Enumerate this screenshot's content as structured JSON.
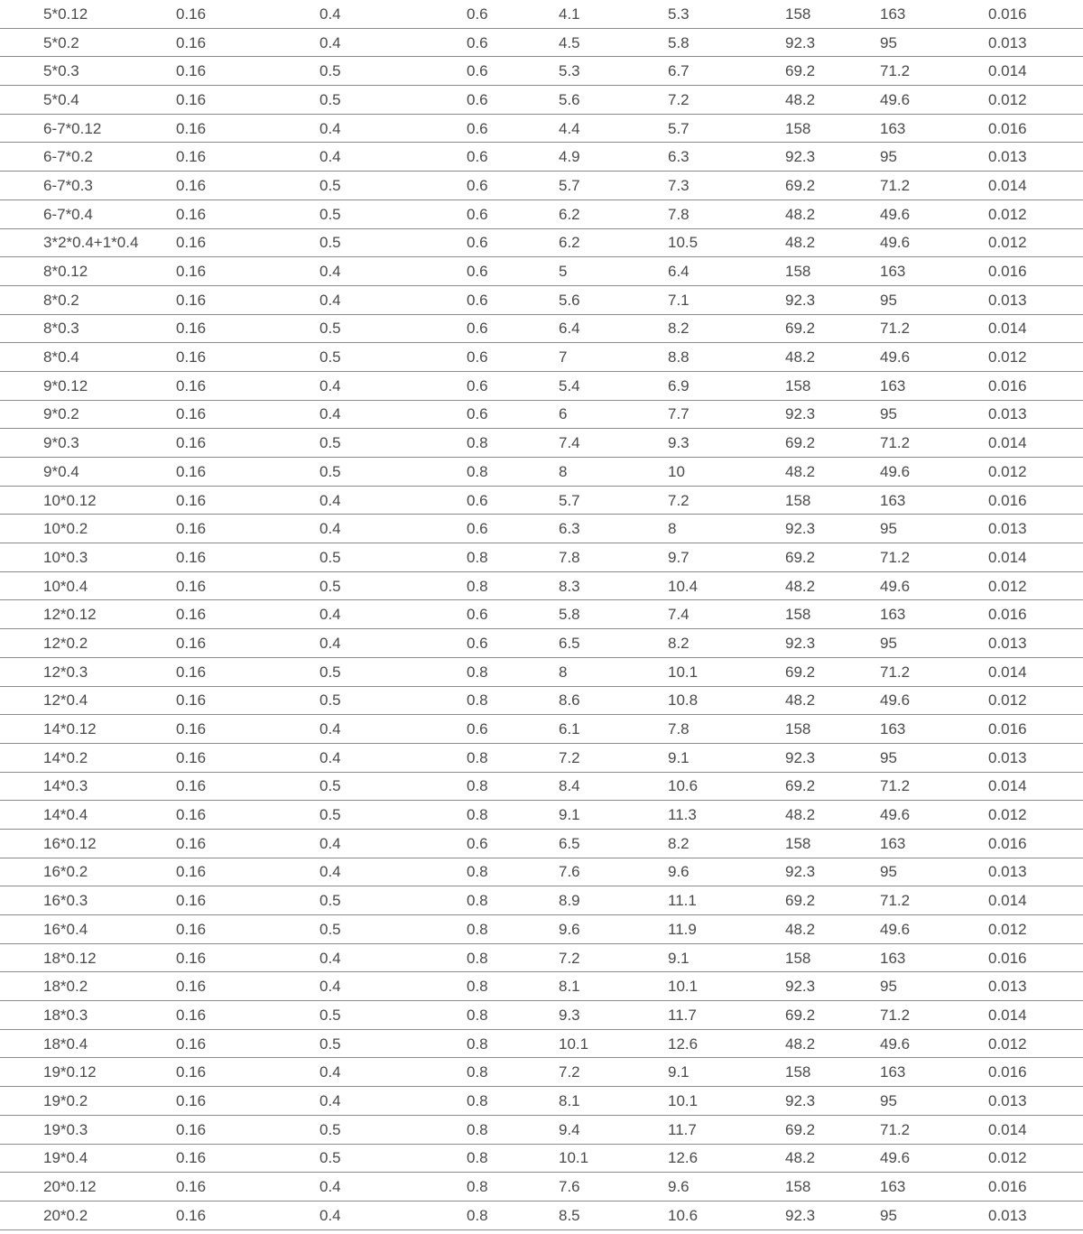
{
  "table": {
    "rows": [
      [
        "5*0.12",
        "0.16",
        "0.4",
        "0.6",
        "4.1",
        "5.3",
        "158",
        "163",
        "0.016"
      ],
      [
        "5*0.2",
        "0.16",
        "0.4",
        "0.6",
        "4.5",
        "5.8",
        "92.3",
        "95",
        "0.013"
      ],
      [
        "5*0.3",
        "0.16",
        "0.5",
        "0.6",
        "5.3",
        "6.7",
        "69.2",
        "71.2",
        "0.014"
      ],
      [
        "5*0.4",
        "0.16",
        "0.5",
        "0.6",
        "5.6",
        "7.2",
        "48.2",
        "49.6",
        "0.012"
      ],
      [
        "6-7*0.12",
        "0.16",
        "0.4",
        "0.6",
        "4.4",
        "5.7",
        "158",
        "163",
        "0.016"
      ],
      [
        "6-7*0.2",
        "0.16",
        "0.4",
        "0.6",
        "4.9",
        "6.3",
        "92.3",
        "95",
        "0.013"
      ],
      [
        "6-7*0.3",
        "0.16",
        "0.5",
        "0.6",
        "5.7",
        "7.3",
        "69.2",
        "71.2",
        "0.014"
      ],
      [
        "6-7*0.4",
        "0.16",
        "0.5",
        "0.6",
        "6.2",
        "7.8",
        "48.2",
        "49.6",
        "0.012"
      ],
      [
        "3*2*0.4+1*0.4",
        "0.16",
        "0.5",
        "0.6",
        "6.2",
        "10.5",
        "48.2",
        "49.6",
        "0.012"
      ],
      [
        "8*0.12",
        "0.16",
        "0.4",
        "0.6",
        "5",
        "6.4",
        "158",
        "163",
        "0.016"
      ],
      [
        "8*0.2",
        "0.16",
        "0.4",
        "0.6",
        "5.6",
        "7.1",
        "92.3",
        "95",
        "0.013"
      ],
      [
        "8*0.3",
        "0.16",
        "0.5",
        "0.6",
        "6.4",
        "8.2",
        "69.2",
        "71.2",
        "0.014"
      ],
      [
        "8*0.4",
        "0.16",
        "0.5",
        "0.6",
        "7",
        "8.8",
        "48.2",
        "49.6",
        "0.012"
      ],
      [
        "9*0.12",
        "0.16",
        "0.4",
        "0.6",
        "5.4",
        "6.9",
        "158",
        "163",
        "0.016"
      ],
      [
        "9*0.2",
        "0.16",
        "0.4",
        "0.6",
        "6",
        "7.7",
        "92.3",
        "95",
        "0.013"
      ],
      [
        "9*0.3",
        "0.16",
        "0.5",
        "0.8",
        "7.4",
        "9.3",
        "69.2",
        "71.2",
        "0.014"
      ],
      [
        "9*0.4",
        "0.16",
        "0.5",
        "0.8",
        "8",
        "10",
        "48.2",
        "49.6",
        "0.012"
      ],
      [
        "10*0.12",
        "0.16",
        "0.4",
        "0.6",
        "5.7",
        "7.2",
        "158",
        "163",
        "0.016"
      ],
      [
        "10*0.2",
        "0.16",
        "0.4",
        "0.6",
        "6.3",
        "8",
        "92.3",
        "95",
        "0.013"
      ],
      [
        "10*0.3",
        "0.16",
        "0.5",
        "0.8",
        "7.8",
        "9.7",
        "69.2",
        "71.2",
        "0.014"
      ],
      [
        "10*0.4",
        "0.16",
        "0.5",
        "0.8",
        "8.3",
        "10.4",
        "48.2",
        "49.6",
        "0.012"
      ],
      [
        "12*0.12",
        "0.16",
        "0.4",
        "0.6",
        "5.8",
        "7.4",
        "158",
        "163",
        "0.016"
      ],
      [
        "12*0.2",
        "0.16",
        "0.4",
        "0.6",
        "6.5",
        "8.2",
        "92.3",
        "95",
        "0.013"
      ],
      [
        "12*0.3",
        "0.16",
        "0.5",
        "0.8",
        "8",
        "10.1",
        "69.2",
        "71.2",
        "0.014"
      ],
      [
        "12*0.4",
        "0.16",
        "0.5",
        "0.8",
        "8.6",
        "10.8",
        "48.2",
        "49.6",
        "0.012"
      ],
      [
        "14*0.12",
        "0.16",
        "0.4",
        "0.6",
        "6.1",
        "7.8",
        "158",
        "163",
        "0.016"
      ],
      [
        "14*0.2",
        "0.16",
        "0.4",
        "0.8",
        "7.2",
        "9.1",
        "92.3",
        "95",
        "0.013"
      ],
      [
        "14*0.3",
        "0.16",
        "0.5",
        "0.8",
        "8.4",
        "10.6",
        "69.2",
        "71.2",
        "0.014"
      ],
      [
        "14*0.4",
        "0.16",
        "0.5",
        "0.8",
        "9.1",
        "11.3",
        "48.2",
        "49.6",
        "0.012"
      ],
      [
        "16*0.12",
        "0.16",
        "0.4",
        "0.6",
        "6.5",
        "8.2",
        "158",
        "163",
        "0.016"
      ],
      [
        "16*0.2",
        "0.16",
        "0.4",
        "0.8",
        "7.6",
        "9.6",
        "92.3",
        "95",
        "0.013"
      ],
      [
        "16*0.3",
        "0.16",
        "0.5",
        "0.8",
        "8.9",
        "11.1",
        "69.2",
        "71.2",
        "0.014"
      ],
      [
        "16*0.4",
        "0.16",
        "0.5",
        "0.8",
        "9.6",
        "11.9",
        "48.2",
        "49.6",
        "0.012"
      ],
      [
        "18*0.12",
        "0.16",
        "0.4",
        "0.8",
        "7.2",
        "9.1",
        "158",
        "163",
        "0.016"
      ],
      [
        "18*0.2",
        "0.16",
        "0.4",
        "0.8",
        "8.1",
        "10.1",
        "92.3",
        "95",
        "0.013"
      ],
      [
        "18*0.3",
        "0.16",
        "0.5",
        "0.8",
        "9.3",
        "11.7",
        "69.2",
        "71.2",
        "0.014"
      ],
      [
        "18*0.4",
        "0.16",
        "0.5",
        "0.8",
        "10.1",
        "12.6",
        "48.2",
        "49.6",
        "0.012"
      ],
      [
        "19*0.12",
        "0.16",
        "0.4",
        "0.8",
        "7.2",
        "9.1",
        "158",
        "163",
        "0.016"
      ],
      [
        "19*0.2",
        "0.16",
        "0.4",
        "0.8",
        "8.1",
        "10.1",
        "92.3",
        "95",
        "0.013"
      ],
      [
        "19*0.3",
        "0.16",
        "0.5",
        "0.8",
        "9.4",
        "11.7",
        "69.2",
        "71.2",
        "0.014"
      ],
      [
        "19*0.4",
        "0.16",
        "0.5",
        "0.8",
        "10.1",
        "12.6",
        "48.2",
        "49.6",
        "0.012"
      ],
      [
        "20*0.12",
        "0.16",
        "0.4",
        "0.8",
        "7.6",
        "9.6",
        "158",
        "163",
        "0.016"
      ],
      [
        "20*0.2",
        "0.16",
        "0.4",
        "0.8",
        "8.5",
        "10.6",
        "92.3",
        "95",
        "0.013"
      ]
    ]
  },
  "colors": {
    "text": "#4a4a4a",
    "rule": "#8c8c8c",
    "background": "#ffffff"
  }
}
